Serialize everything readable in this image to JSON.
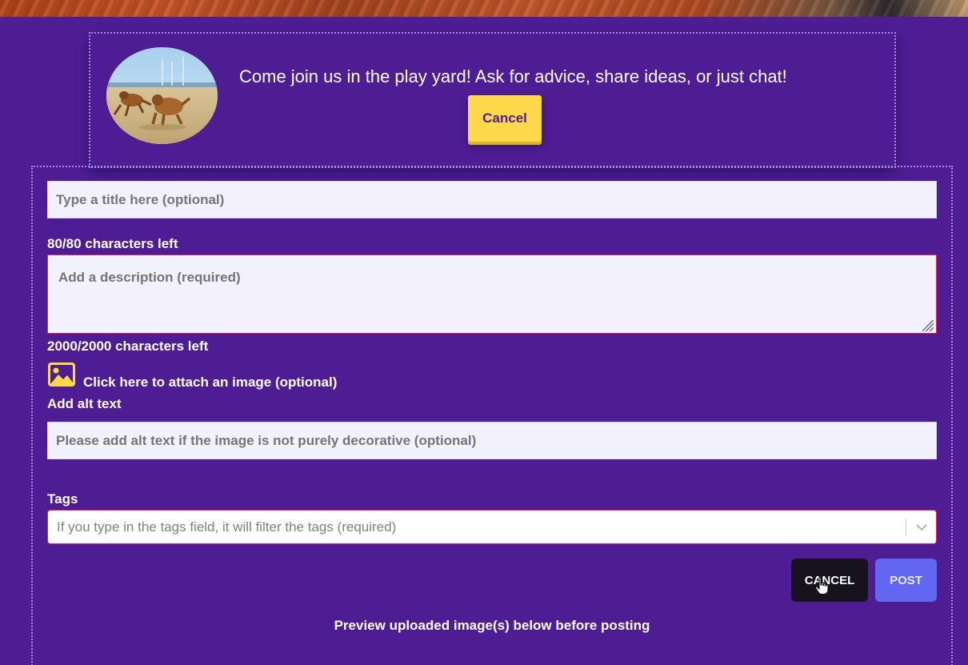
{
  "header": {
    "welcome_text": "Come join us in the play yard! Ask for advice, share ideas, or just chat!",
    "join_button_label": "Cancel"
  },
  "form": {
    "title_placeholder": "Type a title here (optional)",
    "title_counter": "80/80 characters left",
    "description_placeholder": "Add a description (required)",
    "description_counter": "2000/2000 characters left",
    "attach_label": "Click here to attach an image (optional)",
    "alt_label": "Add alt text",
    "alt_placeholder": "Please add alt text if the image is not purely decorative (optional)",
    "tags_label": "Tags",
    "tags_placeholder": "If you type in the tags field, it will filter the tags (required)",
    "cancel_label": "CANCEL",
    "post_label": "POST",
    "preview_text": "Preview uploaded image(s) below before posting"
  },
  "colors": {
    "background": "#4e1d94",
    "accent_yellow": "#fcd84a",
    "post_button": "#6366f1",
    "cancel_button": "#16131f",
    "required_border": "#e0245e"
  },
  "icons": {
    "attach": "image-icon",
    "tags_toggle": "chevron-down-icon",
    "cursor": "hand-pointer-icon"
  }
}
